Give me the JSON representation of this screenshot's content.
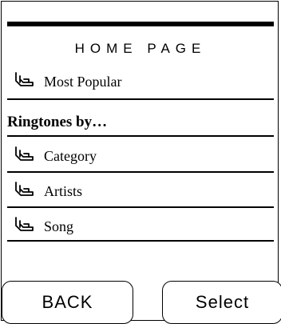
{
  "page": {
    "title": "HOME PAGE",
    "most_popular_label": "Most Popular",
    "section_heading": "Ringtones by…",
    "items": [
      {
        "label": "Category",
        "icon": "hand-pointer-icon"
      },
      {
        "label": "Artists",
        "icon": "hand-pointer-icon"
      },
      {
        "label": "Song",
        "icon": "hand-pointer-icon"
      }
    ]
  },
  "softkeys": {
    "back_label": "BACK",
    "select_label": "Select"
  }
}
